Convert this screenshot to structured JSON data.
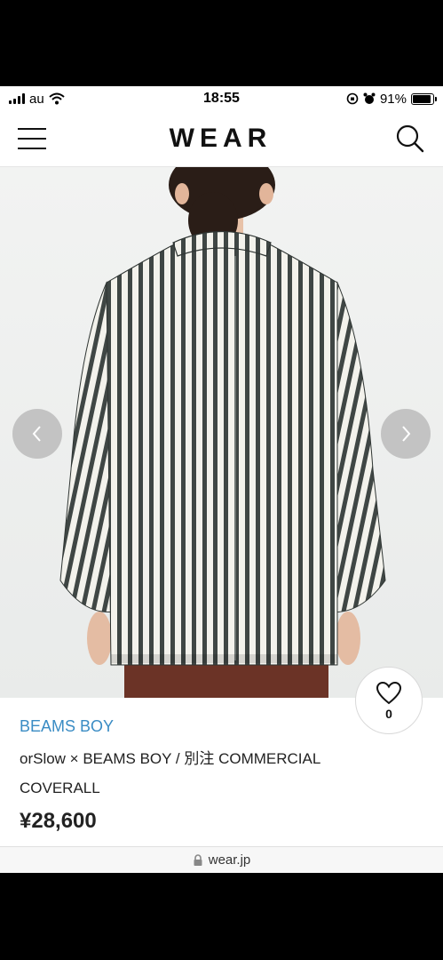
{
  "status_bar": {
    "carrier": "au",
    "time": "18:55",
    "battery": "91%",
    "battery_level": 0.91
  },
  "header": {
    "logo": "WEAR"
  },
  "gallery": {
    "colors": {
      "stripe_dark": "#3f4644",
      "stripe_light": "#f3f2ec",
      "trousers": "#6b3326",
      "hair": "#2a1d17"
    }
  },
  "product": {
    "brand": "BEAMS BOY",
    "title": "orSlow × BEAMS BOY / 別注 COMMERCIAL COVERALL",
    "price": "¥28,600"
  },
  "like": {
    "count": "0"
  },
  "browser": {
    "url": "wear.jp"
  },
  "colors": {
    "brand_link": "#3a8cc4"
  }
}
